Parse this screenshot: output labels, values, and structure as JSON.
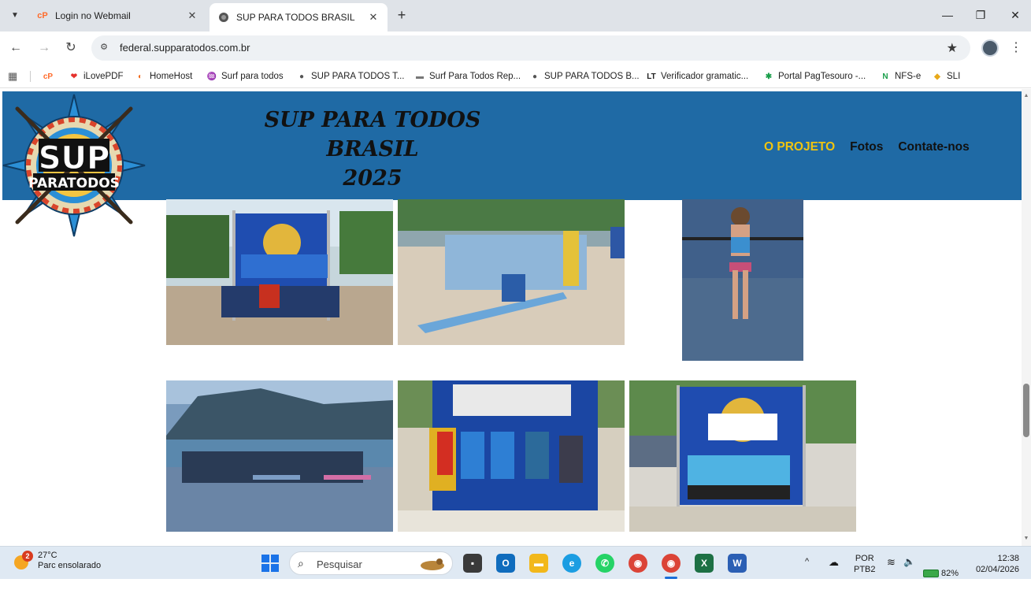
{
  "browser": {
    "tabs": [
      {
        "title": "Login no Webmail",
        "favicon": "cpanel-icon",
        "active": false
      },
      {
        "title": "SUP PARA TODOS BRASIL",
        "favicon": "sup-logo-icon",
        "active": true
      }
    ],
    "url": "federal.supparatodos.com.br",
    "bookmarks": [
      {
        "label": "iLovePDF",
        "icon": "heart-icon"
      },
      {
        "label": "HomeHost",
        "icon": "homehost-icon"
      },
      {
        "label": "Surf para todos",
        "icon": "surf-icon"
      },
      {
        "label": "SUP PARA TODOS T...",
        "icon": "sup-logo-icon"
      },
      {
        "label": "Surf Para Todos Rep...",
        "icon": "report-icon"
      },
      {
        "label": "SUP PARA TODOS B...",
        "icon": "sup-logo-icon"
      },
      {
        "label": "Verificador gramatic...",
        "icon": "lt-icon"
      },
      {
        "label": "Portal PagTesouro -...",
        "icon": "pagtesouro-icon"
      },
      {
        "label": "NFS-e",
        "icon": "nfse-icon"
      },
      {
        "label": "SLI",
        "icon": "sli-icon"
      }
    ]
  },
  "site": {
    "title_line1": "SUP PARA TODOS",
    "title_line2": "BRASIL",
    "title_line3": "2025",
    "logo_text_top": "SUP",
    "logo_text_bottom": "PARATODOS",
    "nav": [
      {
        "label": "O PROJETO",
        "active": true
      },
      {
        "label": "Fotos",
        "active": false
      },
      {
        "label": "Contate-nos",
        "active": false
      }
    ],
    "accent_color": "#f1c40f",
    "header_color": "#1f6aa5"
  },
  "taskbar": {
    "weather_temp": "27°C",
    "weather_desc": "Parc ensolarado",
    "weather_badge": "2",
    "search_placeholder": "Pesquisar",
    "lang_line1": "POR",
    "lang_line2": "PTB2",
    "battery": "82%",
    "time": "12:38",
    "date": "02/04/2026"
  }
}
